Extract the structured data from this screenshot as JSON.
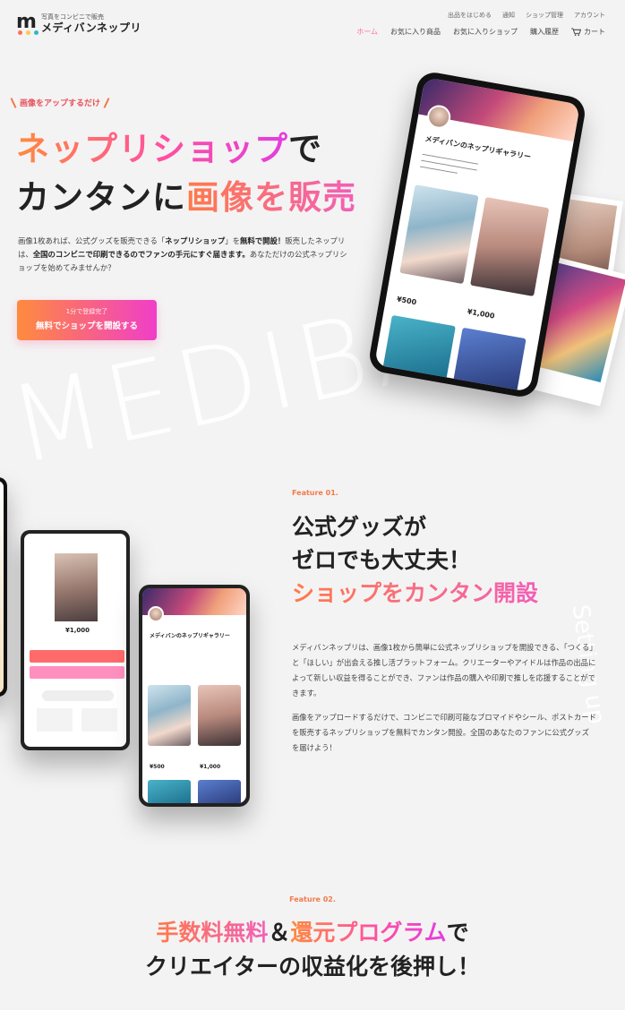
{
  "brand": {
    "tagline": "写真をコンビニで販売",
    "name": "メディバンネップリ"
  },
  "subnav": [
    "出品をはじめる",
    "通知",
    "ショップ管理",
    "アカウント"
  ],
  "nav": {
    "home": "ホーム",
    "fav_products": "お気に入り商品",
    "fav_shops": "お気に入りショップ",
    "history": "購入履歴",
    "cart": "カート"
  },
  "hero": {
    "tag": "画像をアップするだけ",
    "title_line1_grad": "ネップリショップ",
    "title_line1_plain": "で",
    "title_line2_plain": "カンタンに",
    "title_line2_grad": "画像を販売",
    "desc_1": "画像1枚あれば、公式グッズを販売できる「",
    "desc_b1": "ネップリショップ",
    "desc_2": "」を",
    "desc_b2": "無料で開設！",
    "desc_3": "販売したネップリは、",
    "desc_b3": "全国のコンビニで印刷できるのでファンの手元にすぐ届きます。",
    "desc_4": "あなただけの公式ネップリショップを始めてみませんか？",
    "cta_sub": "1分で登録完了",
    "cta_main": "無料でショップを開設する"
  },
  "watermark": "MEDIBA",
  "curved_text": "Setting up",
  "phone_main": {
    "gallery_name": "メディバンのネップリギャラリー",
    "item1_price": "¥500",
    "item2_price": "¥1,000"
  },
  "phone_small": {
    "gallery_name": "メディバンのネップリギャラリー",
    "item1_price": "¥500",
    "item2_price": "¥1,000"
  },
  "phone_left": {
    "price": "¥1,000"
  },
  "feature1": {
    "label": "Feature 01.",
    "title_l1": "公式グッズが",
    "title_l2": "ゼロでも大丈夫！",
    "title_l3": "ショップをカンタン開設",
    "body_p1": "メディバンネップリは、画像1枚から簡単に公式ネップリショップを開設できる、「つくる」と「ほしい」が出会える推し活プラットフォーム。クリエーターやアイドルは作品の出品によって新しい収益を得ることができ、ファンは作品の購入や印刷で推しを応援することができます。",
    "body_p2": "画像をアップロードするだけで、コンビニで印刷可能なブロマイドやシール、ポストカードを販売するネップリショップを無料でカンタン開設。全国のあなたのファンに公式グッズを届けよう！"
  },
  "feature2": {
    "label": "Feature 02.",
    "title_a": "手数料無料",
    "title_amp": "＆",
    "title_b": "還元プログラム",
    "title_c": "で",
    "title_l2": "クリエイターの収益化を後押し！"
  },
  "colors": {
    "accent_orange": "#ff8a3d",
    "accent_pink": "#ff4fa3",
    "accent_magenta": "#e23de0"
  }
}
